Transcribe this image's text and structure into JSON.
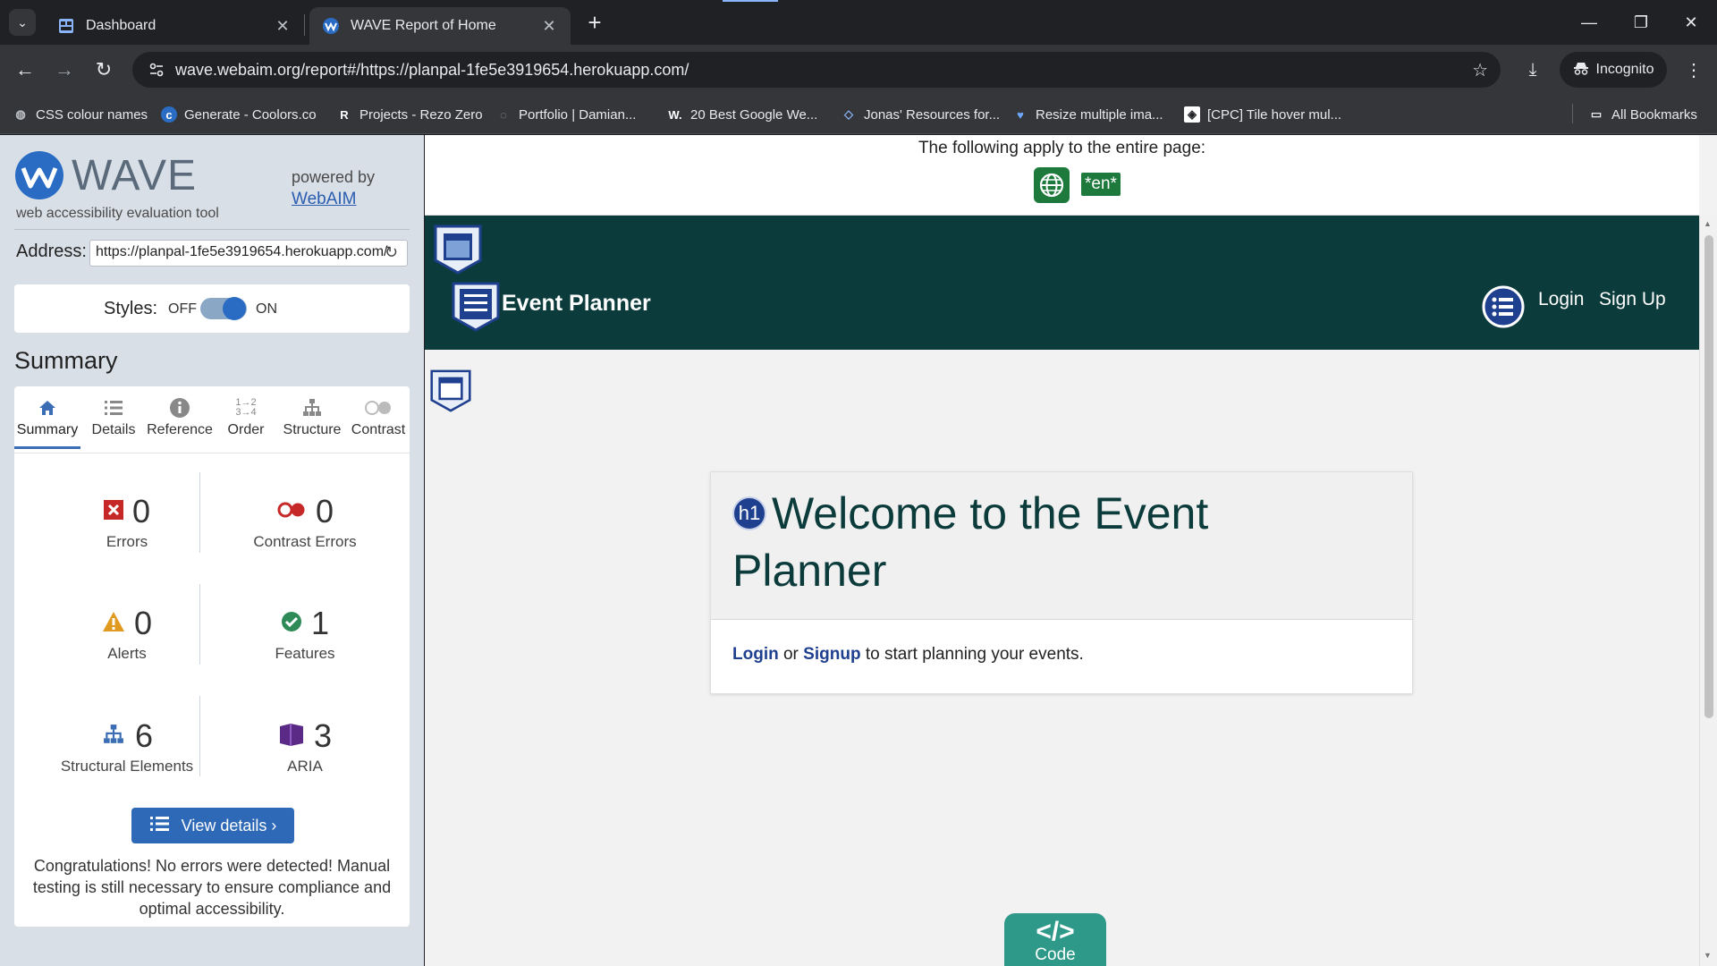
{
  "browser": {
    "tabs": [
      {
        "title": "Dashboard"
      },
      {
        "title": "WAVE Report of Home"
      }
    ],
    "url": "wave.webaim.org/report#/https://planpal-1fe5e3919654.herokuapp.com/",
    "incognito_label": "Incognito",
    "bookmarks": [
      "CSS colour names",
      "Generate - Coolors.co",
      "Projects - Rezo Zero",
      "Portfolio | Damian...",
      "20 Best Google We...",
      "Jonas' Resources for...",
      "Resize multiple ima...",
      "[CPC] Tile hover mul..."
    ],
    "all_bookmarks": "All Bookmarks"
  },
  "wave": {
    "logo_text": "WAVE",
    "subtitle": "web accessibility evaluation tool",
    "powered_by": "powered by",
    "webaim_link": "WebAIM",
    "address_label": "Address:",
    "address_value": "https://planpal-1fe5e3919654.herokuapp.com/",
    "styles_label": "Styles:",
    "styles_off": "OFF",
    "styles_on": "ON",
    "styles_enabled": true,
    "summary_heading": "Summary",
    "tabs": [
      "Summary",
      "Details",
      "Reference",
      "Order",
      "Structure",
      "Contrast"
    ],
    "selected_tab": "Summary",
    "counts": {
      "errors": {
        "value": "0",
        "label": "Errors"
      },
      "contrast": {
        "value": "0",
        "label": "Contrast Errors"
      },
      "alerts": {
        "value": "0",
        "label": "Alerts"
      },
      "features": {
        "value": "1",
        "label": "Features"
      },
      "structural": {
        "value": "6",
        "label": "Structural Elements"
      },
      "aria": {
        "value": "3",
        "label": "ARIA"
      }
    },
    "view_details": "View details ›",
    "congrats": "Congratulations! No errors were detected! Manual testing is still necessary to ensure compliance and optimal accessibility."
  },
  "page": {
    "applies_text": "The following apply to the entire page:",
    "lang_badge": "*en*",
    "brand": "Event Planner",
    "nav_login": "Login",
    "nav_signup": "Sign Up",
    "hero_title": "Welcome to the Event Planner",
    "h1_badge": "h1",
    "hero_login": "Login",
    "hero_or": "or",
    "hero_signup": "Signup",
    "hero_rest": "to start planning your events.",
    "code_tab": "Code",
    "code_glyph": "</>"
  },
  "colors": {
    "nav_bg": "#0b3b3a",
    "accent_blue": "#2d69b6",
    "wave_panel": "#d9dfe7",
    "error_red": "#c62828",
    "alert_orange": "#e09a1f",
    "feature_green": "#2e8b57",
    "aria_purple": "#5b2a86",
    "code_teal": "#2e9989"
  }
}
